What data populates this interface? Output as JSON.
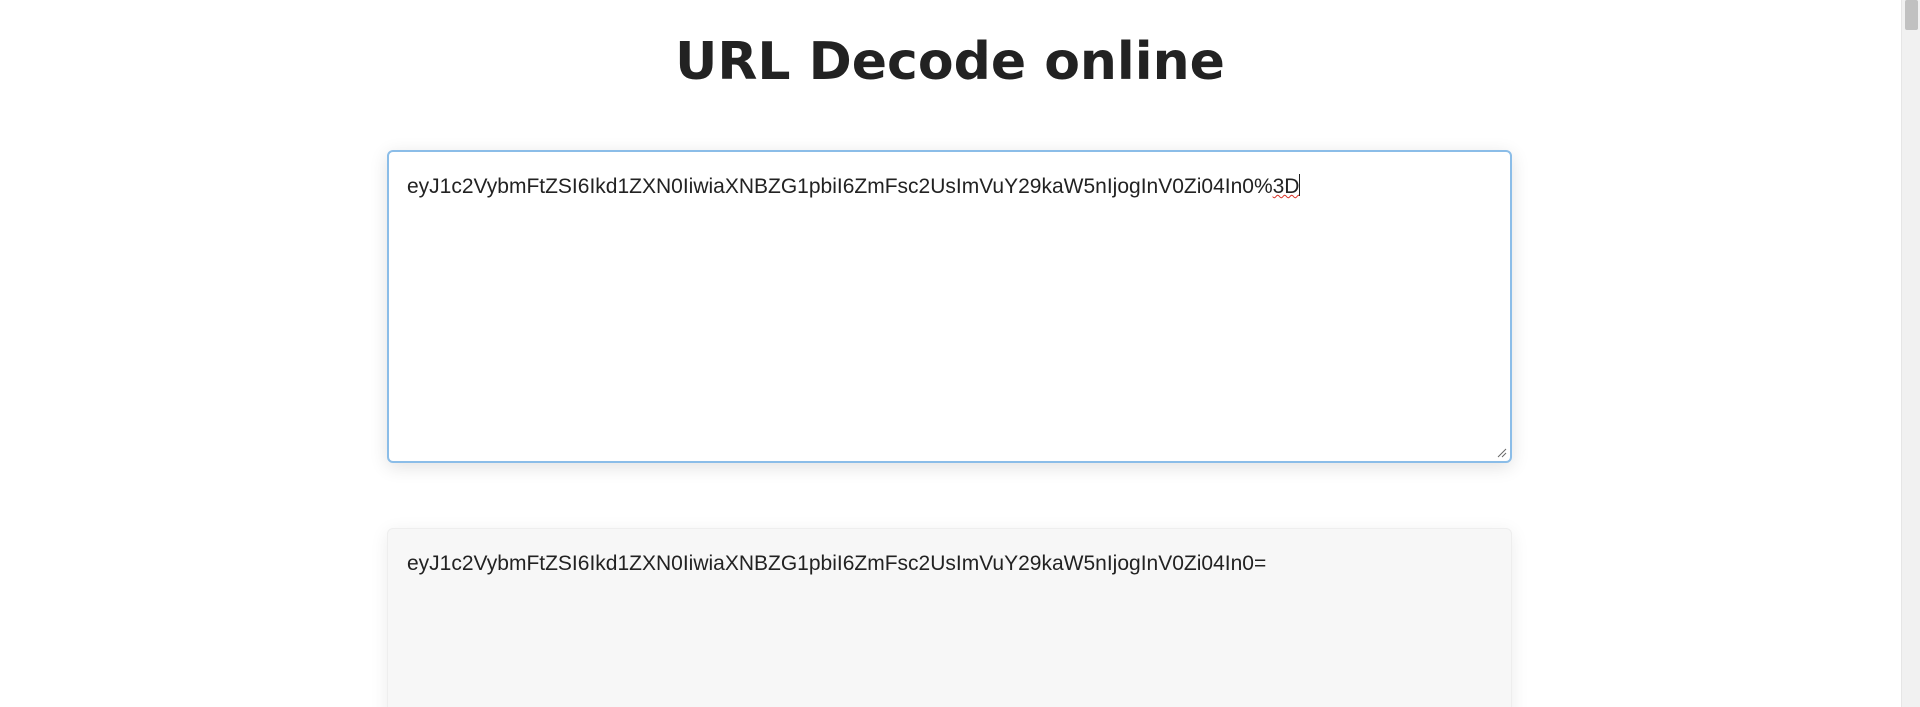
{
  "page": {
    "title": "URL Decode online"
  },
  "input": {
    "value_main": "eyJ1c2VybmFtZSI6Ikd1ZXN0IiwiaXNBZG1pbiI6ZmFsc2UsImVuY29kaW5nIjogInV0Zi04In0%",
    "value_flagged": "3D"
  },
  "output": {
    "value": "eyJ1c2VybmFtZSI6Ikd1ZXN0IiwiaXNBZG1pbiI6ZmFsc2UsImVuY29kaW5nIjogInV0Zi04In0="
  },
  "colors": {
    "focus_border": "#8bbde8",
    "output_background": "#f7f7f7",
    "spellcheck_underline": "#d93025"
  }
}
